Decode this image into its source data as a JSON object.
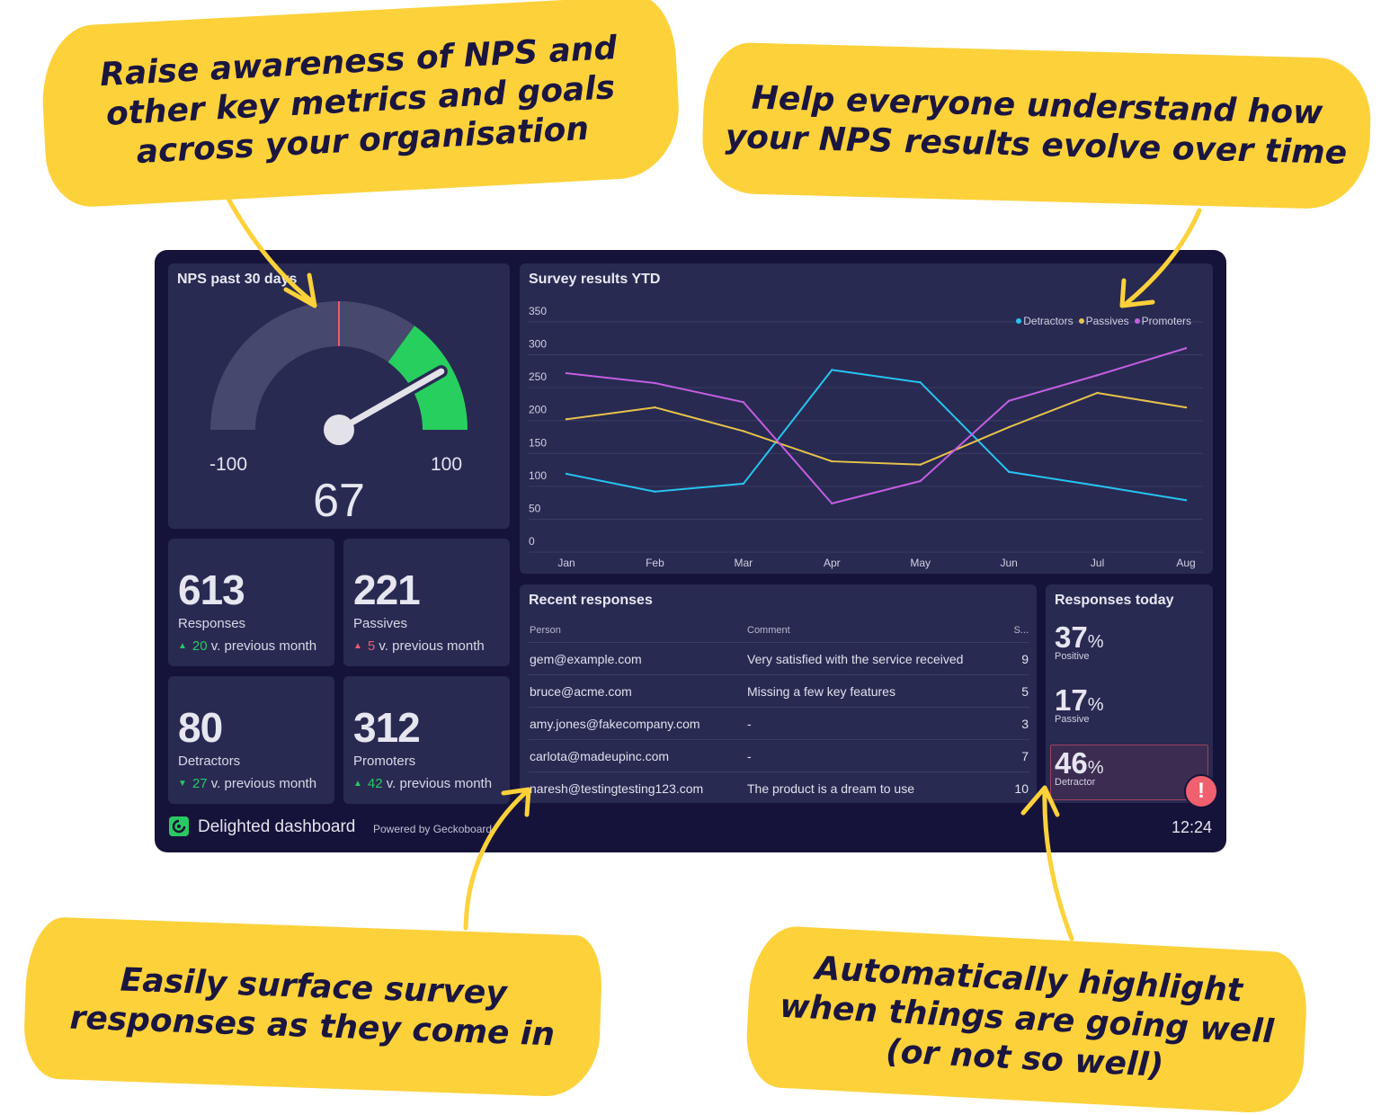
{
  "callouts": {
    "top_left": [
      "Raise awareness of NPS and",
      "other key metrics and goals",
      "across your organisation"
    ],
    "top_right": [
      "Help everyone understand how",
      "your NPS results evolve over time"
    ],
    "bottom_left": [
      "Easily surface survey",
      "responses as they come in"
    ],
    "bottom_right": [
      "Automatically highlight",
      "when things are going well",
      "(or not so well)"
    ]
  },
  "gauge": {
    "title": "NPS past 30 days",
    "min_label": "-100",
    "max_label": "100",
    "min": -100,
    "max": 100,
    "value": 67,
    "value_label": "67",
    "marker": 0,
    "green_from": 40,
    "colors": {
      "track": "#46486e",
      "good": "#27cf5e",
      "marker": "#f05a6b",
      "needle": "#e2e2e8"
    }
  },
  "stats": [
    {
      "value": "613",
      "label": "Responses",
      "change": "20",
      "change_suffix": "v. previous month",
      "direction": "up",
      "sentiment": "good"
    },
    {
      "value": "221",
      "label": "Passives",
      "change": "5",
      "change_suffix": "v. previous month",
      "direction": "up",
      "sentiment": "bad"
    },
    {
      "value": "80",
      "label": "Detractors",
      "change": "27",
      "change_suffix": "v. previous month",
      "direction": "down",
      "sentiment": "good"
    },
    {
      "value": "312",
      "label": "Promoters",
      "change": "42",
      "change_suffix": "v. previous month",
      "direction": "up",
      "sentiment": "good"
    }
  ],
  "chart_data": {
    "type": "line",
    "title": "Survey results YTD",
    "xlabel": "",
    "ylabel": "",
    "categories": [
      "Jan",
      "Feb",
      "Mar",
      "Apr",
      "May",
      "Jun",
      "Jul",
      "Aug"
    ],
    "yticks": [
      0,
      50,
      100,
      150,
      200,
      250,
      300,
      350
    ],
    "ylim": [
      0,
      350
    ],
    "grid": true,
    "legend": "top-right",
    "series": [
      {
        "name": "Detractors",
        "color": "#27c4ef",
        "values": [
          119,
          92,
          104,
          277,
          258,
          122,
          101,
          79
        ]
      },
      {
        "name": "Passives",
        "color": "#e6c34b",
        "values": [
          202,
          220,
          184,
          138,
          133,
          190,
          242,
          220
        ]
      },
      {
        "name": "Promoters",
        "color": "#c45ee0",
        "values": [
          272,
          257,
          228,
          74,
          108,
          230,
          269,
          310
        ]
      }
    ]
  },
  "table": {
    "title": "Recent responses",
    "headers": [
      "Person",
      "Comment",
      "S..."
    ],
    "rows": [
      [
        "gem@example.com",
        "Very satisfied with the service received",
        "9"
      ],
      [
        "bruce@acme.com",
        "Missing a few key features",
        "5"
      ],
      [
        "amy.jones@fakecompany.com",
        "-",
        "3"
      ],
      [
        "carlota@madeupinc.com",
        "-",
        "7"
      ],
      [
        "naresh@testingtesting123.com",
        "The product is a dream to use",
        "10"
      ]
    ]
  },
  "today": {
    "title": "Responses today",
    "items": [
      {
        "value": "37",
        "unit": "%",
        "label": "Positive"
      },
      {
        "value": "17",
        "unit": "%",
        "label": "Passive"
      },
      {
        "value": "46",
        "unit": "%",
        "label": "Detractor",
        "alert": true
      }
    ],
    "alert_icon": "!"
  },
  "footer": {
    "title": "Delighted dashboard",
    "powered": "Powered by Geckoboard",
    "clock": "12:24"
  }
}
